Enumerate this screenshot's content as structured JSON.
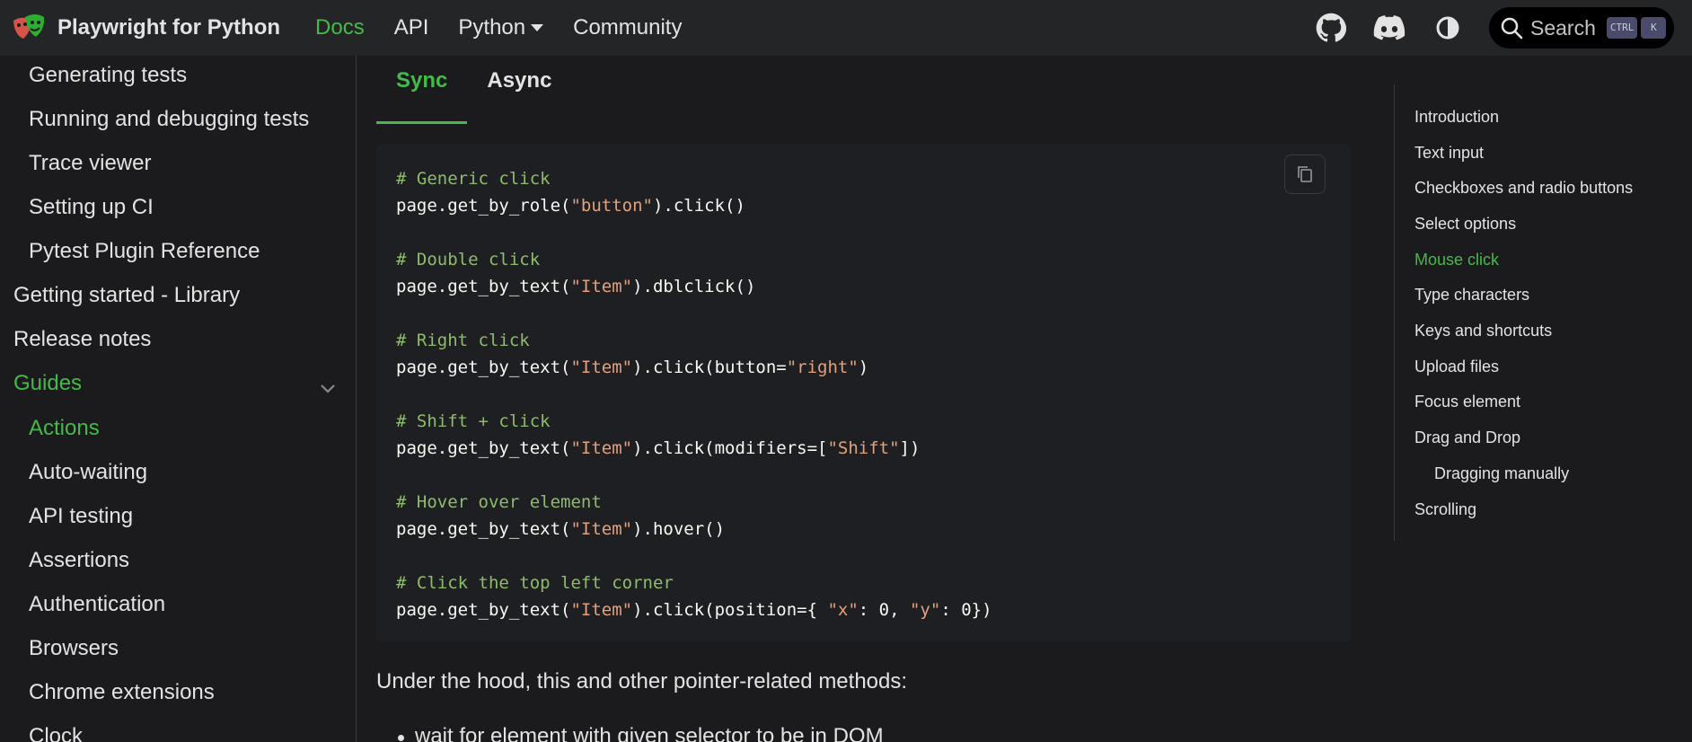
{
  "navbar": {
    "brand": "Playwright for Python",
    "links": [
      {
        "label": "Docs"
      },
      {
        "label": "API"
      },
      {
        "label": "Python"
      },
      {
        "label": "Community"
      }
    ],
    "search_label": "Search",
    "kbd_ctrl": "CTRL",
    "kbd_k": "K",
    "icons": [
      "github-icon",
      "discord-icon",
      "theme-toggle-icon",
      "search-icon"
    ]
  },
  "sidebar": {
    "items": [
      {
        "label": "Generating tests"
      },
      {
        "label": "Running and debugging tests"
      },
      {
        "label": "Trace viewer"
      },
      {
        "label": "Setting up CI"
      },
      {
        "label": "Pytest Plugin Reference"
      },
      {
        "label": "Getting started - Library"
      },
      {
        "label": "Release notes"
      },
      {
        "label": "Guides"
      },
      {
        "label": "Actions"
      },
      {
        "label": "Auto-waiting"
      },
      {
        "label": "API testing"
      },
      {
        "label": "Assertions"
      },
      {
        "label": "Authentication"
      },
      {
        "label": "Browsers"
      },
      {
        "label": "Chrome extensions"
      },
      {
        "label": "Clock"
      }
    ]
  },
  "tabs": [
    {
      "label": "Sync"
    },
    {
      "label": "Async"
    }
  ],
  "code": {
    "lines": [
      [
        {
          "t": "# Generic click",
          "k": "comment"
        }
      ],
      [
        {
          "t": "page.get_by_role(",
          "k": "plain"
        },
        {
          "t": "\"button\"",
          "k": "str"
        },
        {
          "t": ").click()",
          "k": "plain"
        }
      ],
      [],
      [
        {
          "t": "# Double click",
          "k": "comment"
        }
      ],
      [
        {
          "t": "page.get_by_text(",
          "k": "plain"
        },
        {
          "t": "\"Item\"",
          "k": "str"
        },
        {
          "t": ").dblclick()",
          "k": "plain"
        }
      ],
      [],
      [
        {
          "t": "# Right click",
          "k": "comment"
        }
      ],
      [
        {
          "t": "page.get_by_text(",
          "k": "plain"
        },
        {
          "t": "\"Item\"",
          "k": "str"
        },
        {
          "t": ").click(button=",
          "k": "plain"
        },
        {
          "t": "\"right\"",
          "k": "str"
        },
        {
          "t": ")",
          "k": "plain"
        }
      ],
      [],
      [
        {
          "t": "# Shift + click",
          "k": "comment"
        }
      ],
      [
        {
          "t": "page.get_by_text(",
          "k": "plain"
        },
        {
          "t": "\"Item\"",
          "k": "str"
        },
        {
          "t": ").click(modifiers=[",
          "k": "plain"
        },
        {
          "t": "\"Shift\"",
          "k": "str"
        },
        {
          "t": "])",
          "k": "plain"
        }
      ],
      [],
      [
        {
          "t": "# Hover over element",
          "k": "comment"
        }
      ],
      [
        {
          "t": "page.get_by_text(",
          "k": "plain"
        },
        {
          "t": "\"Item\"",
          "k": "str"
        },
        {
          "t": ").hover()",
          "k": "plain"
        }
      ],
      [],
      [
        {
          "t": "# Click the top left corner",
          "k": "comment"
        }
      ],
      [
        {
          "t": "page.get_by_text(",
          "k": "plain"
        },
        {
          "t": "\"Item\"",
          "k": "str"
        },
        {
          "t": ").click(position={ ",
          "k": "plain"
        },
        {
          "t": "\"x\"",
          "k": "str"
        },
        {
          "t": ": 0, ",
          "k": "plain"
        },
        {
          "t": "\"y\"",
          "k": "str"
        },
        {
          "t": ": 0})",
          "k": "plain"
        }
      ]
    ]
  },
  "content": {
    "paragraph": "Under the hood, this and other pointer-related methods:",
    "bullet": "wait for element with given selector to be in DOM"
  },
  "toc": {
    "items": [
      {
        "label": "Introduction"
      },
      {
        "label": "Text input"
      },
      {
        "label": "Checkboxes and radio buttons"
      },
      {
        "label": "Select options"
      },
      {
        "label": "Mouse click"
      },
      {
        "label": "Type characters"
      },
      {
        "label": "Keys and shortcuts"
      },
      {
        "label": "Upload files"
      },
      {
        "label": "Focus element"
      },
      {
        "label": "Drag and Drop"
      },
      {
        "label": "Dragging manually"
      },
      {
        "label": "Scrolling"
      }
    ]
  },
  "colors": {
    "accent": "#45ba4b",
    "background": "#1b1b1d",
    "navbar": "#242526",
    "code_bg": "#1e1f22",
    "comment": "#8fbc6a",
    "string": "#e6a07b"
  }
}
